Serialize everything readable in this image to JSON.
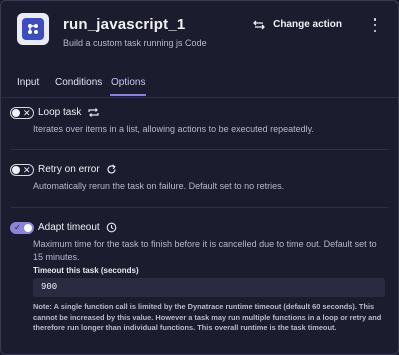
{
  "header": {
    "title": "run_javascript_1",
    "subtitle": "Build a custom task running js Code",
    "change_action_label": "Change action"
  },
  "tabs": [
    {
      "label": "Input",
      "active": false
    },
    {
      "label": "Conditions",
      "active": false
    },
    {
      "label": "Options",
      "active": true
    }
  ],
  "options": {
    "loop_task": {
      "label": "Loop task",
      "enabled": false,
      "description": "Iterates over items in a list, allowing actions to be executed repeatedly."
    },
    "retry_on_error": {
      "label": "Retry on error",
      "enabled": false,
      "description": "Automatically rerun the task on failure. Default set to no retries."
    },
    "adapt_timeout": {
      "label": "Adapt timeout",
      "enabled": true,
      "description": "Maximum time for the task to finish before it is cancelled due to time out. Default set to 15 minutes.",
      "field_label": "Timeout this task (seconds)",
      "field_value": "900",
      "note": "Note: A single function call is limited by the Dynatrace runtime timeout (default 60 seconds). This cannot be increased by this value. However a task may run multiple functions in a loop or retry and therefore run longer than individual functions. This overall runtime is the task timeout."
    }
  },
  "icons": {
    "app": "workflow-app-icon",
    "change_action": "swap-arrows-icon",
    "more": "more-vertical-icon",
    "loop": "loop-icon",
    "retry": "retry-icon",
    "timeout": "clock-icon"
  },
  "colors": {
    "background": "#1b1c2e",
    "accent": "#8b7df0",
    "toggle_on": "#8d84d9",
    "input_bg": "#2a2b40"
  }
}
